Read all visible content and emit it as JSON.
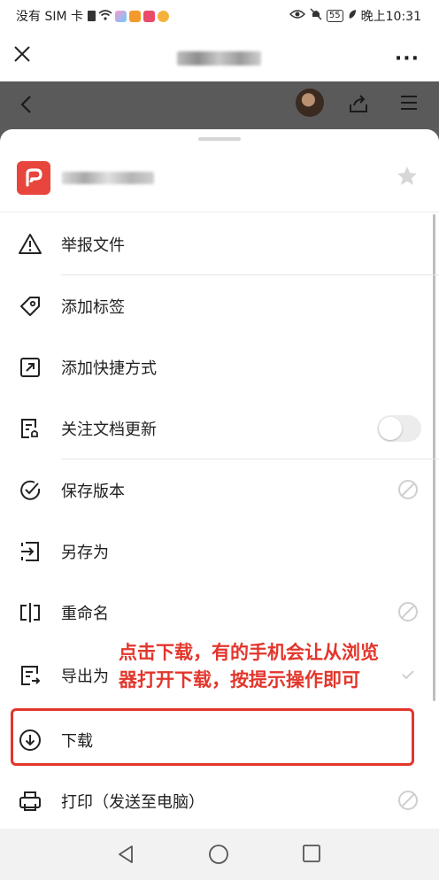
{
  "status_bar": {
    "carrier": "没有 SIM 卡",
    "battery": "55",
    "time": "晚上10:31"
  },
  "sheet": {
    "items": [
      {
        "label": "举报文件",
        "icon": "warning-triangle-icon"
      },
      {
        "label": "添加标签",
        "icon": "tag-icon"
      },
      {
        "label": "添加快捷方式",
        "icon": "shortcut-icon"
      },
      {
        "label": "关注文档更新",
        "icon": "doc-follow-icon",
        "toggle": false
      },
      {
        "label": "保存版本",
        "icon": "check-circle-icon"
      },
      {
        "label": "另存为",
        "icon": "save-as-icon"
      },
      {
        "label": "重命名",
        "icon": "rename-icon"
      },
      {
        "label": "导出为",
        "icon": "export-icon"
      },
      {
        "label": "下载",
        "icon": "download-icon"
      },
      {
        "label": "打印（发送至电脑）",
        "icon": "print-icon"
      }
    ]
  },
  "annotation": {
    "line1": "点击下载，有的手机会让从浏览",
    "line2": "器打开下载，按提示操作即可",
    "color": "#e3362c"
  },
  "colors": {
    "file_logo": "#e8453c",
    "dim_header": "#5a5a5a"
  }
}
